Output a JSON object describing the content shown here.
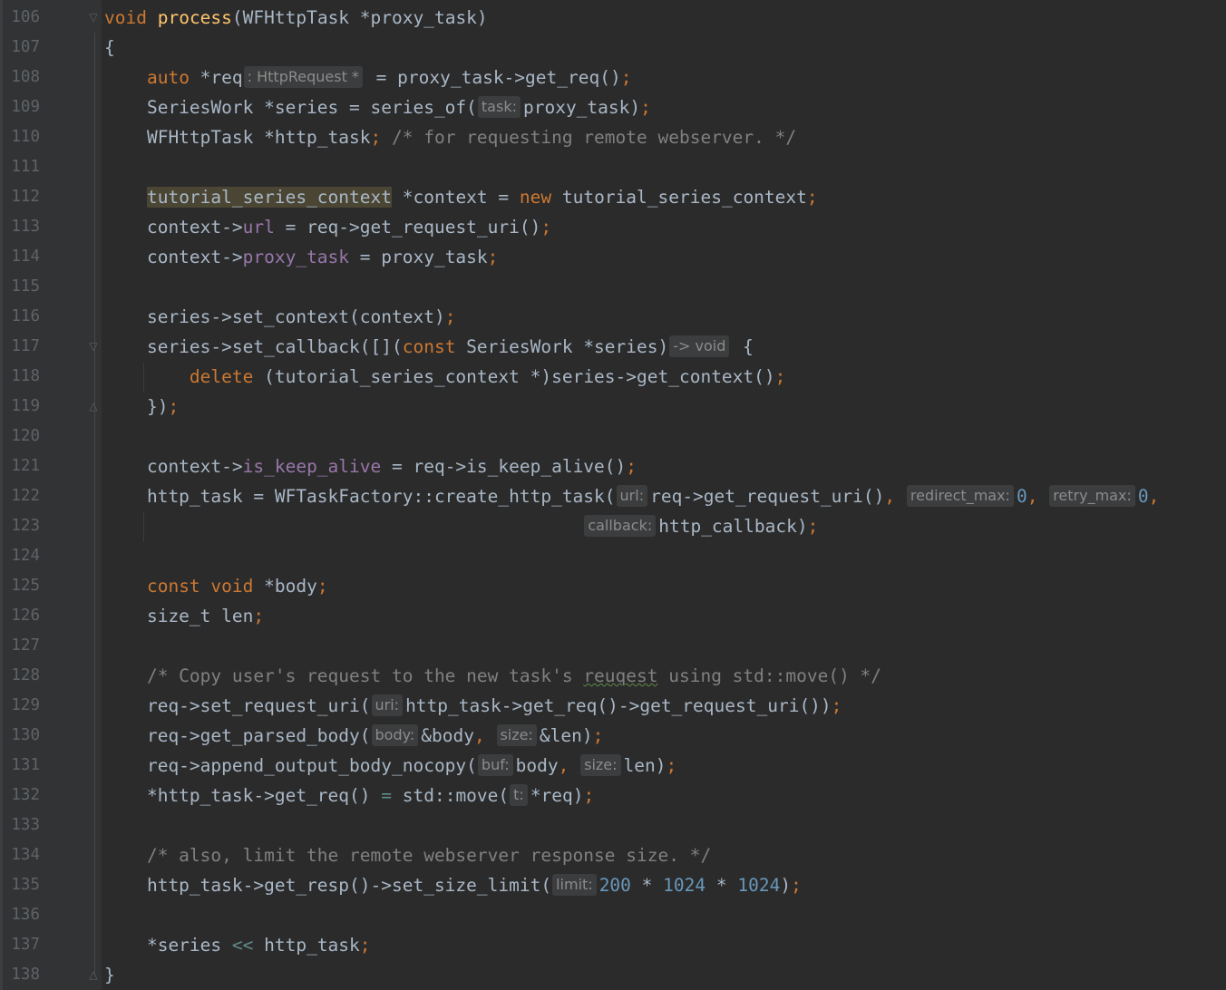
{
  "editor": {
    "language": "cpp",
    "colors": {
      "background": "#2b2b2b",
      "gutter": "#313335",
      "line_number": "#606366",
      "keyword": "#cc7832",
      "function": "#ffc66d",
      "text": "#a9b7c6",
      "field": "#9876aa",
      "number": "#6897bb",
      "comment": "#808080",
      "inlay_hint_bg": "#3b3d3e"
    },
    "folding_markers": [
      {
        "line": "106",
        "icon": "fold-open-icon"
      },
      {
        "line": "117",
        "icon": "fold-open-icon"
      },
      {
        "line": "119",
        "icon": "fold-close-icon"
      },
      {
        "line": "138",
        "icon": "fold-close-icon"
      }
    ],
    "lines": [
      {
        "number": "106",
        "tokens": [
          {
            "t": "void",
            "c": "kw"
          },
          {
            "t": " ",
            "c": "tx"
          },
          {
            "t": "process",
            "c": "fn"
          },
          {
            "t": "(WFHttpTask *proxy_task)",
            "c": "tx"
          }
        ]
      },
      {
        "number": "107",
        "tokens": [
          {
            "t": "{",
            "c": "tx"
          }
        ]
      },
      {
        "number": "108",
        "tokens": [
          {
            "t": "    ",
            "c": "tx"
          },
          {
            "t": "auto",
            "c": "kw"
          },
          {
            "t": " *req",
            "c": "tx"
          },
          {
            "t": ": HttpRequest *",
            "c": "hint"
          },
          {
            "t": " = proxy_task->get_req()",
            "c": "tx"
          },
          {
            "t": ";",
            "c": "punct"
          }
        ]
      },
      {
        "number": "109",
        "tokens": [
          {
            "t": "    SeriesWork *series = series_of(",
            "c": "tx"
          },
          {
            "t": "task:",
            "c": "hint"
          },
          {
            "t": "proxy_task)",
            "c": "tx"
          },
          {
            "t": ";",
            "c": "punct"
          }
        ]
      },
      {
        "number": "110",
        "tokens": [
          {
            "t": "    WFHttpTask *http_task",
            "c": "tx"
          },
          {
            "t": ";",
            "c": "punct"
          },
          {
            "t": " /* for requesting remote webserver. */",
            "c": "comment"
          }
        ]
      },
      {
        "number": "111",
        "tokens": []
      },
      {
        "number": "112",
        "tokens": [
          {
            "t": "    ",
            "c": "tx"
          },
          {
            "t": "tutorial_series_context",
            "c": "type-hl"
          },
          {
            "t": " *context = ",
            "c": "tx"
          },
          {
            "t": "new",
            "c": "kw"
          },
          {
            "t": " tutorial_series_context",
            "c": "tx"
          },
          {
            "t": ";",
            "c": "punct"
          }
        ]
      },
      {
        "number": "113",
        "tokens": [
          {
            "t": "    context->",
            "c": "tx"
          },
          {
            "t": "url",
            "c": "field"
          },
          {
            "t": " = req->get_request_uri()",
            "c": "tx"
          },
          {
            "t": ";",
            "c": "punct"
          }
        ]
      },
      {
        "number": "114",
        "tokens": [
          {
            "t": "    context->",
            "c": "tx"
          },
          {
            "t": "proxy_task",
            "c": "field"
          },
          {
            "t": " = proxy_task",
            "c": "tx"
          },
          {
            "t": ";",
            "c": "punct"
          }
        ]
      },
      {
        "number": "115",
        "tokens": []
      },
      {
        "number": "116",
        "tokens": [
          {
            "t": "    series->set_context(context)",
            "c": "tx"
          },
          {
            "t": ";",
            "c": "punct"
          }
        ]
      },
      {
        "number": "117",
        "tokens": [
          {
            "t": "    series->set_callback([](",
            "c": "tx"
          },
          {
            "t": "const",
            "c": "kw"
          },
          {
            "t": " SeriesWork *series)",
            "c": "tx"
          },
          {
            "t": "-> void",
            "c": "hint"
          },
          {
            "t": " {",
            "c": "tx"
          }
        ]
      },
      {
        "number": "118",
        "tokens": [
          {
            "t": "        ",
            "c": "tx"
          },
          {
            "t": "delete",
            "c": "kw"
          },
          {
            "t": " (tutorial_series_context *)series->get_context()",
            "c": "tx"
          },
          {
            "t": ";",
            "c": "punct"
          }
        ]
      },
      {
        "number": "119",
        "tokens": [
          {
            "t": "    })",
            "c": "tx"
          },
          {
            "t": ";",
            "c": "punct"
          }
        ]
      },
      {
        "number": "120",
        "tokens": []
      },
      {
        "number": "121",
        "tokens": [
          {
            "t": "    context->",
            "c": "tx"
          },
          {
            "t": "is_keep_alive",
            "c": "field"
          },
          {
            "t": " = req->is_keep_alive()",
            "c": "tx"
          },
          {
            "t": ";",
            "c": "punct"
          }
        ]
      },
      {
        "number": "122",
        "tokens": [
          {
            "t": "    http_task = WFTaskFactory::create_http_task(",
            "c": "tx"
          },
          {
            "t": "url:",
            "c": "hint"
          },
          {
            "t": "req->get_request_uri()",
            "c": "tx"
          },
          {
            "t": ",",
            "c": "punct"
          },
          {
            "t": " ",
            "c": "tx"
          },
          {
            "t": "redirect_max:",
            "c": "hint"
          },
          {
            "t": "0",
            "c": "num"
          },
          {
            "t": ",",
            "c": "punct"
          },
          {
            "t": " ",
            "c": "tx"
          },
          {
            "t": "retry_max:",
            "c": "hint"
          },
          {
            "t": "0",
            "c": "num"
          },
          {
            "t": ",",
            "c": "punct"
          }
        ]
      },
      {
        "number": "123",
        "tokens": [
          {
            "t": "                                             ",
            "c": "tx"
          },
          {
            "t": "callback:",
            "c": "hint"
          },
          {
            "t": "http_callback)",
            "c": "tx"
          },
          {
            "t": ";",
            "c": "punct"
          }
        ]
      },
      {
        "number": "124",
        "tokens": []
      },
      {
        "number": "125",
        "tokens": [
          {
            "t": "    ",
            "c": "tx"
          },
          {
            "t": "const void",
            "c": "kw"
          },
          {
            "t": " *body",
            "c": "tx"
          },
          {
            "t": ";",
            "c": "punct"
          }
        ]
      },
      {
        "number": "126",
        "tokens": [
          {
            "t": "    size_t len",
            "c": "tx"
          },
          {
            "t": ";",
            "c": "punct"
          }
        ]
      },
      {
        "number": "127",
        "tokens": []
      },
      {
        "number": "128",
        "tokens": [
          {
            "t": "    /* Copy user's request to the new task's ",
            "c": "comment"
          },
          {
            "t": "reuqest",
            "c": "typo"
          },
          {
            "t": " using std::move() */",
            "c": "comment"
          }
        ]
      },
      {
        "number": "129",
        "tokens": [
          {
            "t": "    req->set_request_uri(",
            "c": "tx"
          },
          {
            "t": "uri:",
            "c": "hint"
          },
          {
            "t": "http_task->get_req()->get_request_uri())",
            "c": "tx"
          },
          {
            "t": ";",
            "c": "punct"
          }
        ]
      },
      {
        "number": "130",
        "tokens": [
          {
            "t": "    req->get_parsed_body(",
            "c": "tx"
          },
          {
            "t": "body:",
            "c": "hint"
          },
          {
            "t": "&body",
            "c": "tx"
          },
          {
            "t": ",",
            "c": "punct"
          },
          {
            "t": " ",
            "c": "tx"
          },
          {
            "t": "size:",
            "c": "hint"
          },
          {
            "t": "&len)",
            "c": "tx"
          },
          {
            "t": ";",
            "c": "punct"
          }
        ]
      },
      {
        "number": "131",
        "tokens": [
          {
            "t": "    req->append_output_body_nocopy(",
            "c": "tx"
          },
          {
            "t": "buf:",
            "c": "hint"
          },
          {
            "t": "body",
            "c": "tx"
          },
          {
            "t": ",",
            "c": "punct"
          },
          {
            "t": " ",
            "c": "tx"
          },
          {
            "t": "size:",
            "c": "hint"
          },
          {
            "t": "len)",
            "c": "tx"
          },
          {
            "t": ";",
            "c": "punct"
          }
        ]
      },
      {
        "number": "132",
        "tokens": [
          {
            "t": "    *http_task->get_req() ",
            "c": "tx"
          },
          {
            "t": "=",
            "c": "op-green"
          },
          {
            "t": " std::move(",
            "c": "tx"
          },
          {
            "t": "t:",
            "c": "hint"
          },
          {
            "t": "*req)",
            "c": "tx"
          },
          {
            "t": ";",
            "c": "punct"
          }
        ]
      },
      {
        "number": "133",
        "tokens": []
      },
      {
        "number": "134",
        "tokens": [
          {
            "t": "    /* also, limit the remote webserver response size. */",
            "c": "comment"
          }
        ]
      },
      {
        "number": "135",
        "tokens": [
          {
            "t": "    http_task->get_resp()->set_size_limit(",
            "c": "tx"
          },
          {
            "t": "limit:",
            "c": "hint"
          },
          {
            "t": "200",
            "c": "num"
          },
          {
            "t": " * ",
            "c": "tx"
          },
          {
            "t": "1024",
            "c": "num"
          },
          {
            "t": " * ",
            "c": "tx"
          },
          {
            "t": "1024",
            "c": "num"
          },
          {
            "t": ")",
            "c": "tx"
          },
          {
            "t": ";",
            "c": "punct"
          }
        ]
      },
      {
        "number": "136",
        "tokens": []
      },
      {
        "number": "137",
        "tokens": [
          {
            "t": "    *series ",
            "c": "tx"
          },
          {
            "t": "<<",
            "c": "op-green"
          },
          {
            "t": " http_task",
            "c": "tx"
          },
          {
            "t": ";",
            "c": "punct"
          }
        ]
      },
      {
        "number": "138",
        "tokens": [
          {
            "t": "}",
            "c": "tx"
          }
        ]
      }
    ]
  }
}
